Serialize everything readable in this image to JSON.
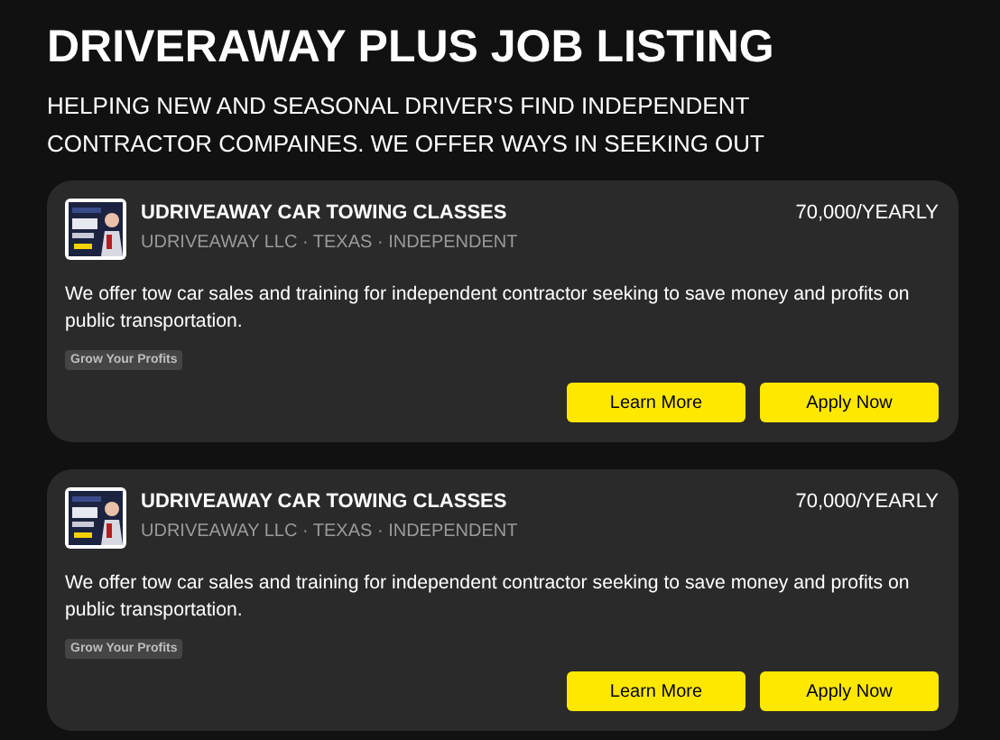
{
  "page": {
    "title": "DRIVERAWAY PLUS JOB LISTING",
    "subtitle": "HELPING NEW AND SEASONAL DRIVER'S FIND INDEPENDENT CONTRACTOR COMPAINES. WE OFFER WAYS IN SEEKING OUT"
  },
  "listings": [
    {
      "thumbnail": {
        "kind": "picture"
      },
      "title": "UDRIVEAWAY CAR TOWING CLASSES",
      "meta": "UDRIVEAWAY LLC · TEXAS · INDEPENDENT",
      "pay": "70,000/YEARLY",
      "description": "We offer tow car sales and training for independent contractor seeking to save money and profits on public transportation.",
      "tags": [
        "Grow Your Profits"
      ],
      "buttons": [
        "Learn More",
        "Apply Now"
      ]
    },
    {
      "thumbnail": {
        "kind": "picture"
      },
      "title": "UDRIVEAWAY CAR TOWING CLASSES",
      "meta": "UDRIVEAWAY LLC · TEXAS · INDEPENDENT",
      "pay": "70,000/YEARLY",
      "description": "We offer tow car sales and training for independent contractor seeking to save money and profits on public transportation.",
      "tags": [
        "Grow Your Profits"
      ],
      "buttons": [
        "Learn More",
        "Apply Now"
      ]
    }
  ]
}
